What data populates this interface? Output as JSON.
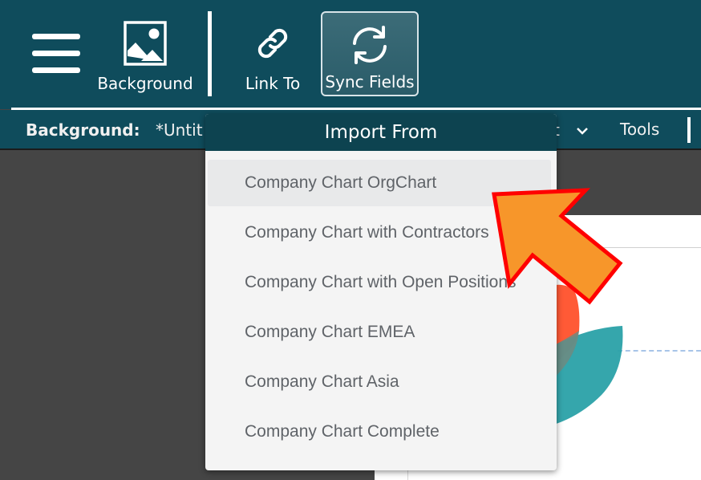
{
  "toolbar": {
    "menu_icon": "hamburger-menu-icon",
    "buttons": [
      {
        "label": "Background",
        "icon": "image-icon"
      },
      {
        "label": "Link To",
        "icon": "link-icon"
      },
      {
        "label": "Sync Fields",
        "icon": "sync-icon",
        "active": true
      }
    ]
  },
  "subbar": {
    "label": "Background:",
    "document": "*Untit",
    "hidden_menu_tail": "t",
    "tools_label": "Tools"
  },
  "dropdown": {
    "title": "Import From",
    "items": [
      {
        "label": "Company Chart OrgChart",
        "highlighted": true
      },
      {
        "label": "Company Chart with Contractors"
      },
      {
        "label": "Company Chart with Open Positions"
      },
      {
        "label": "Company Chart EMEA"
      },
      {
        "label": "Company Chart Asia"
      },
      {
        "label": "Company Chart Complete"
      }
    ]
  },
  "annotation": {
    "type": "arrow-pointer",
    "fill": "#f7962a",
    "stroke": "#ff0000"
  },
  "colors": {
    "toolbar_bg": "#0f4c5c",
    "dropdown_header_bg": "#0d4350",
    "workspace_bg": "#454545",
    "logo_orange": "#ff5a36",
    "logo_teal": "#2aa1a8"
  }
}
